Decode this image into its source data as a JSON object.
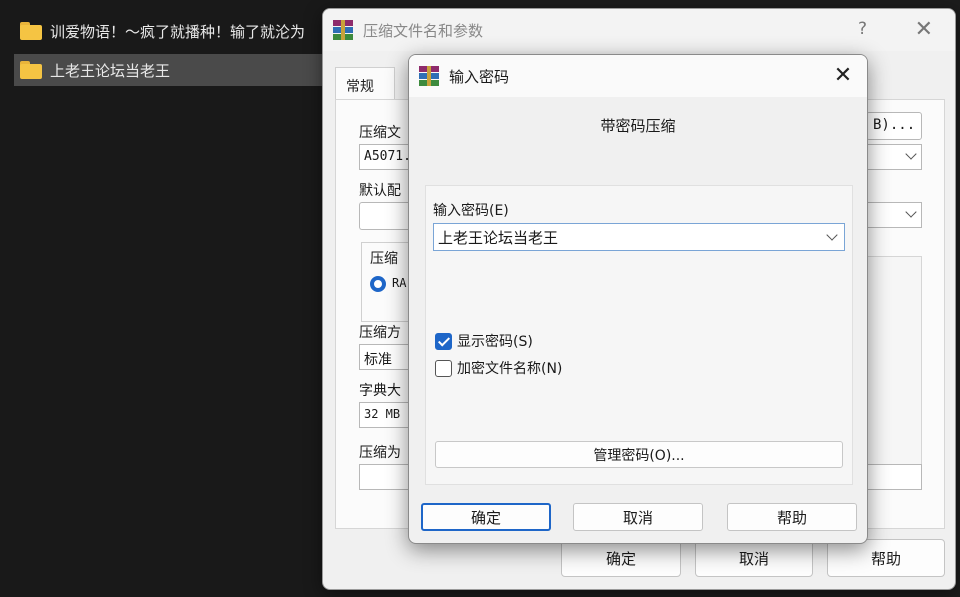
{
  "explorer": {
    "items": [
      {
        "name": "训爱物语！～疯了就播种！输了就沦为"
      },
      {
        "name": "上老王论坛当老王"
      }
    ]
  },
  "back_dialog": {
    "title": "压缩文件名和参数",
    "help_glyph": "?",
    "close_glyph": "✕",
    "tab_general": "常规",
    "label_archive_name": "压缩文",
    "archive_name_value": "A5071.",
    "browse_button_fragment": "B)...",
    "label_default_profile": "默认配",
    "label_format_group": "压缩",
    "format_option_fragment": "RA",
    "label_method": "压缩方",
    "method_value": "标准",
    "label_dict": "字典大",
    "dict_value": "32 MB",
    "label_split": "压缩为",
    "ok": "确定",
    "cancel": "取消",
    "help": "帮助"
  },
  "password_dialog": {
    "title": "输入密码",
    "close_glyph": "✕",
    "heading": "带密码压缩",
    "label_password": "输入密码(E)",
    "password_value": "上老王论坛当老王",
    "show_password_label": "显示密码(S)",
    "show_password_checked": true,
    "encrypt_names_label": "加密文件名称(N)",
    "encrypt_names_checked": false,
    "manage_button": "管理密码(O)...",
    "ok": "确定",
    "cancel": "取消",
    "help": "帮助"
  },
  "colors": {
    "accent": "#1e66c8",
    "folder": "#f5c443"
  }
}
